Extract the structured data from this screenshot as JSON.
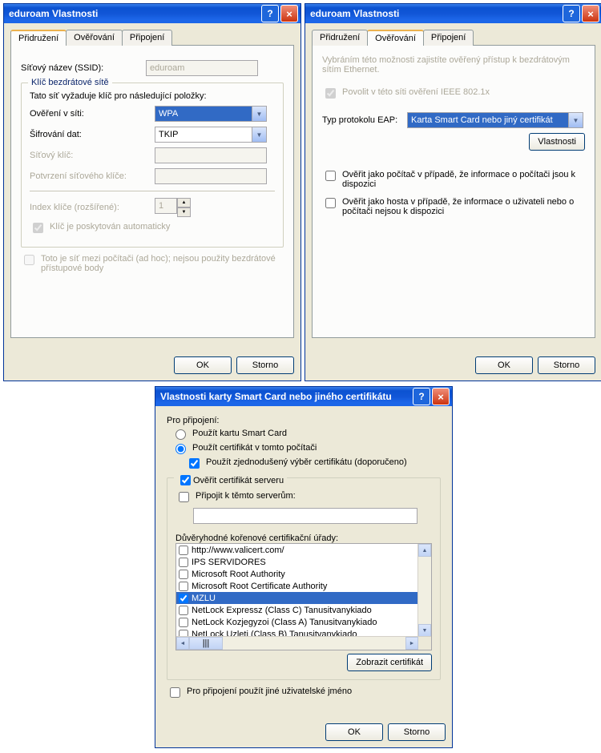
{
  "w1": {
    "title": "eduroam Vlastnosti",
    "tabs": [
      "Přidružení",
      "Ověřování",
      "Připojení"
    ],
    "ssid_label": "Síťový název (SSID):",
    "ssid_value": "eduroam",
    "groupbox_legend": "Klíč bezdrátové sítě",
    "keymsg": "Tato síť vyžaduje klíč pro následující položky:",
    "auth_label": "Ověření v síti:",
    "auth_value": "WPA",
    "enc_label": "Šifrování dat:",
    "enc_value": "TKIP",
    "netkey_label": "Síťový klíč:",
    "confirm_label": "Potvrzení síťového klíče:",
    "index_label": "Index klíče (rozšířené):",
    "index_value": "1",
    "autokey": "Klíč je poskytován automaticky",
    "adhoc": "Toto je síť mezi počítači (ad hoc); nejsou použity bezdrátové přístupové body",
    "ok": "OK",
    "cancel": "Storno"
  },
  "w2": {
    "title": "eduroam Vlastnosti",
    "tabs": [
      "Přidružení",
      "Ověřování",
      "Připojení"
    ],
    "desc": "Vybráním této možnosti zajistíte ověřený přístup k bezdrátovým sítím Ethernet.",
    "enable8021x": "Povolit v této síti ověření IEEE 802.1x",
    "eap_label": "Typ protokolu EAP:",
    "eap_value": "Karta Smart Card nebo jiný certifikát",
    "props": "Vlastnosti",
    "chk1": "Ověřit jako počítač v případě, že informace o počítači jsou k dispozici",
    "chk2": "Ověřit jako hosta v případě, že informace o uživateli nebo o počítači nejsou k dispozici",
    "ok": "OK",
    "cancel": "Storno"
  },
  "w3": {
    "title": "Vlastnosti karty Smart Card nebo jiného certifikátu",
    "connect_label": "Pro připojení:",
    "radio1": "Použít kartu Smart Card",
    "radio2": "Použít certifikát v tomto počítači",
    "simple": "Použít zjednodušený výběr certifikátu (doporučeno)",
    "validate": "Ověřit certifikát serveru",
    "connect_srv": "Připojit k těmto serverům:",
    "ca_label": "Důvěryhodné kořenové certifikační úřady:",
    "items": [
      "http://www.valicert.com/",
      "IPS SERVIDORES",
      "Microsoft Root Authority",
      "Microsoft Root Certificate Authority",
      "MZLU",
      "NetLock Expressz (Class C) Tanusitvanykiado",
      "NetLock Kozjegyzoi (Class A) Tanusitvanykiado",
      "NetLock Uzleti (Class B) Tanusitvanykiado"
    ],
    "showcert": "Zobrazit certifikát",
    "diffuser": "Pro připojení použít jiné uživatelské jméno",
    "ok": "OK",
    "cancel": "Storno"
  }
}
